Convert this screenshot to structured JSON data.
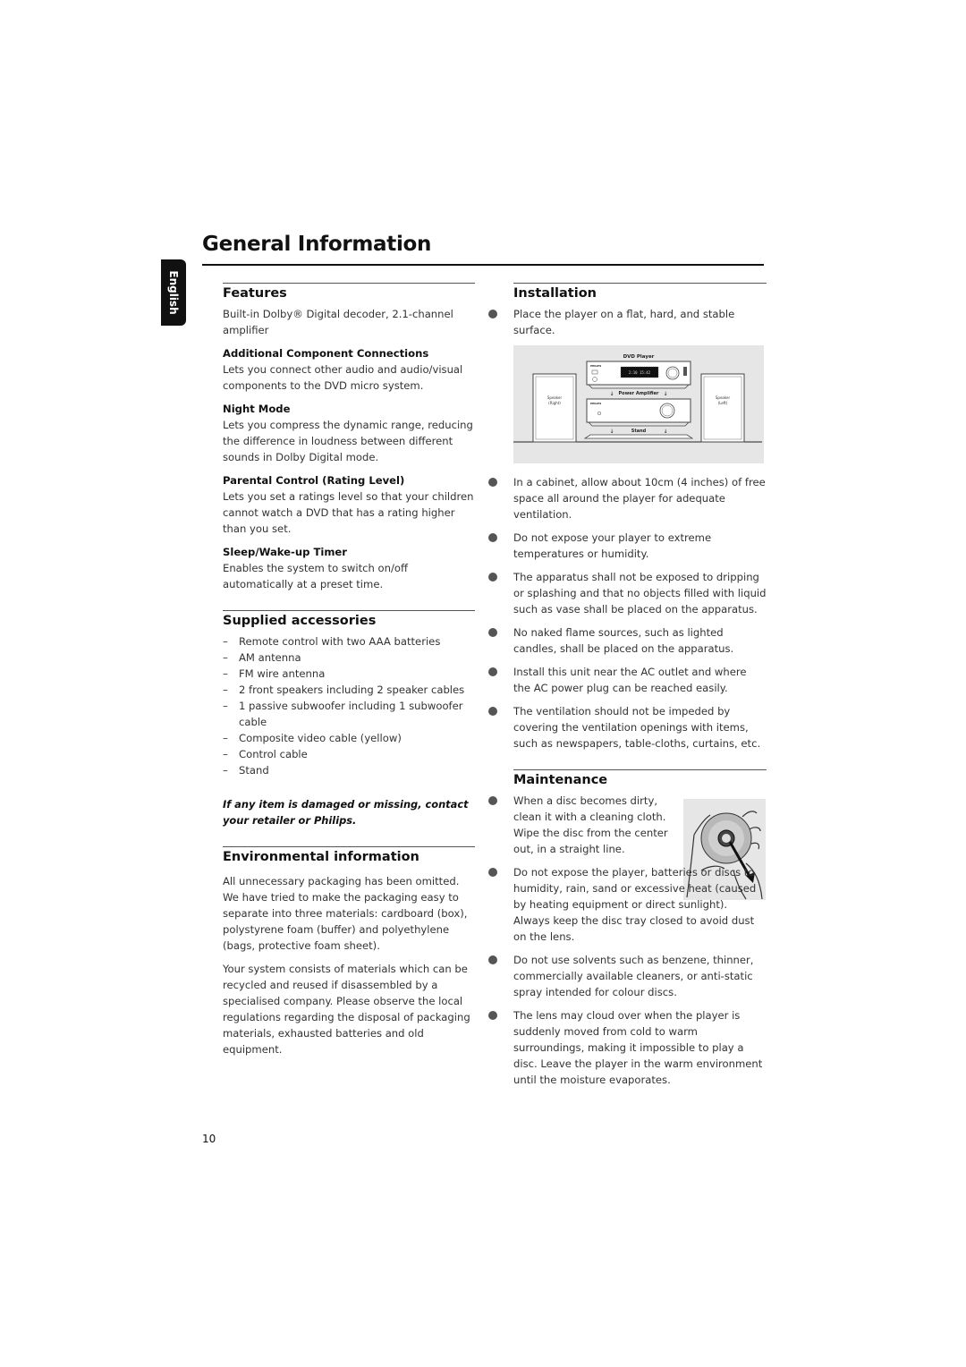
{
  "header": {
    "title": "General Information",
    "language_tab": "English"
  },
  "features": {
    "title": "Features",
    "intro": "Built-in Dolby® Digital decoder, 2.1-channel amplifier",
    "items": [
      {
        "heading": "Additional Component Connections",
        "text": "Lets you connect other audio and audio/visual components to the DVD micro system."
      },
      {
        "heading": "Night Mode",
        "text": "Lets you compress the dynamic range, reducing the difference in loudness between different sounds in Dolby Digital mode."
      },
      {
        "heading": "Parental Control (Rating Level)",
        "text": "Lets you set a ratings level so that your children cannot watch a DVD that has a rating higher than you set."
      },
      {
        "heading": "Sleep/Wake-up Timer",
        "text": "Enables the system to switch on/off automatically at a preset time."
      }
    ]
  },
  "accessories": {
    "title": "Supplied accessories",
    "dash": "–",
    "items": [
      "Remote control with two AAA batteries",
      "AM antenna",
      "FM wire antenna",
      "2 front speakers including 2 speaker cables",
      "1 passive subwoofer including 1 subwoofer cable",
      "Composite video cable (yellow)",
      "Control cable",
      "Stand"
    ],
    "note": "If any item is damaged or missing, contact your retailer or Philips."
  },
  "environment": {
    "title": "Environmental information",
    "paragraphs": [
      "All unnecessary packaging has been omitted. We have tried to make the packaging easy to separate into three materials: cardboard (box), polystyrene foam (buffer) and polyethylene (bags, protective foam sheet).",
      "Your system consists of materials which can be recycled and reused if disassembled by a specialised company. Please observe the local regulations regarding the disposal of packaging materials, exhausted batteries and old equipment."
    ]
  },
  "installation": {
    "title": "Installation",
    "first": "Place the player on a flat, hard, and stable surface.",
    "figure": {
      "dvd_label": "DVD Player",
      "amp_label": "Power Amplifier",
      "stand_label": "Stand",
      "speaker_right": "Speaker",
      "speaker_right_sub": "(Right)",
      "speaker_left": "Speaker",
      "speaker_left_sub": "(Left)",
      "brand": "PHILIPS",
      "display": "2:10  15:42"
    },
    "bullets": [
      "In a cabinet, allow about 10cm (4 inches) of free space all around the player for adequate ventilation.",
      "Do not expose your player to extreme temperatures or humidity.",
      "The apparatus shall not be exposed to dripping or splashing and that no objects  filled with liquid such as vase shall be placed on the apparatus.",
      "No naked flame sources, such as lighted candles, shall be placed on the apparatus.",
      "Install this unit near the AC outlet and where the AC power plug can be reached easily.",
      "The ventilation should not be impeded by covering the ventilation openings with items, such as newspapers, table-cloths, curtains, etc."
    ]
  },
  "maintenance": {
    "title": "Maintenance",
    "bullets": [
      "When a disc becomes dirty, clean it with a cleaning cloth. Wipe the disc from the center out, in a straight line.",
      "Do not expose the player, batteries or discs to humidity, rain, sand or excessive heat (caused by heating equipment or direct sunlight). Always keep the disc tray closed to avoid dust on the lens.",
      "Do not use solvents such as benzene, thinner, commercially available cleaners, or anti-static spray intended for colour discs.",
      "The lens may cloud over when the player is suddenly moved from cold to warm surroundings, making it impossible to play a disc. Leave the player in the warm environment until the moisture evaporates."
    ]
  },
  "footer": {
    "page_number": "10"
  }
}
